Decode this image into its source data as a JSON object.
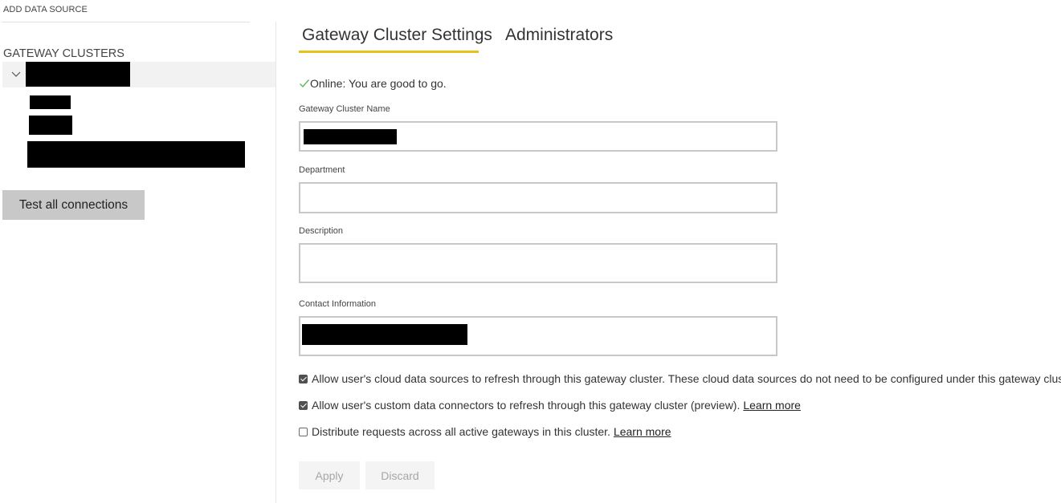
{
  "header": {
    "add_data_source_label": "ADD DATA SOURCE"
  },
  "sidebar": {
    "title": "GATEWAY CLUSTERS",
    "expand_icon": "chevron-down-icon",
    "test_all_label": "Test all connections"
  },
  "tabs": [
    {
      "label": "Gateway Cluster Settings",
      "active": true
    },
    {
      "label": "Administrators",
      "active": false
    }
  ],
  "status": {
    "text": "Online: You are good to go.",
    "icon": "check-icon",
    "color": "#5cb85c"
  },
  "form": {
    "cluster_name_label": "Gateway Cluster Name",
    "department_label": "Department",
    "description_label": "Description",
    "contact_label": "Contact Information",
    "department_value": "",
    "description_value": ""
  },
  "options": [
    {
      "text": "Allow user's cloud data sources to refresh through this gateway cluster. These cloud data sources do not need to be configured under this gateway clus",
      "checked": true,
      "link": ""
    },
    {
      "text": "Allow user's custom data connectors to refresh through this gateway cluster (preview).",
      "checked": true,
      "link": "Learn more"
    },
    {
      "text": "Distribute requests across all active gateways in this cluster.",
      "checked": false,
      "link": "Learn more"
    }
  ],
  "actions": {
    "apply_label": "Apply",
    "discard_label": "Discard"
  },
  "colors": {
    "accent": "#e8c21c",
    "redaction": "#000000"
  }
}
